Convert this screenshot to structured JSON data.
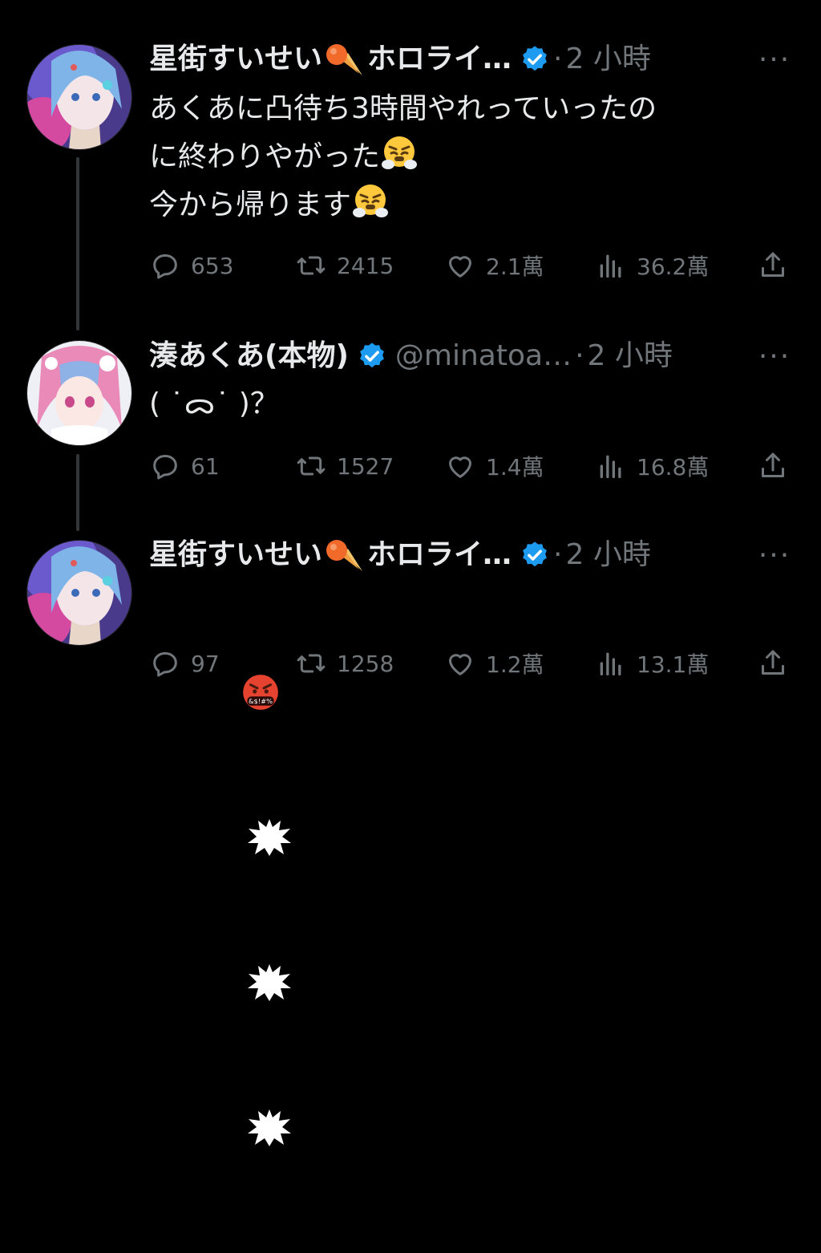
{
  "tweets": [
    {
      "name_prefix": "星街すいせい",
      "name_suffix": "ホロライ…",
      "handle": "",
      "separator": "·",
      "time": "2 小時",
      "more": "···",
      "body_lines": [
        "あくあに凸待ち3時間やれっていったの",
        "に終わりやがった",
        "今から帰ります"
      ],
      "body_emoji_name": "face-with-steam-from-nose-emoji",
      "replies": "653",
      "retweets": "2415",
      "likes": "2.1萬",
      "views": "36.2萬"
    },
    {
      "name_prefix": "湊あくあ(本物)",
      "name_suffix": "",
      "handle": "@minatoa…",
      "separator": "·",
      "time": "2 小時",
      "more": "···",
      "body_lines": [
        "( ˙ᯅ˙ )？"
      ],
      "replies": "61",
      "retweets": "1527",
      "likes": "1.4萬",
      "views": "16.8萬"
    },
    {
      "name_prefix": "星街すいせい",
      "name_suffix": "ホロライ…",
      "handle": "",
      "separator": "·",
      "time": "2 小時",
      "more": "···",
      "body_emoji_name": "face-with-symbols-on-mouth-emoji",
      "body_emoji_text": "&$!#%",
      "replies": "97",
      "retweets": "1258",
      "likes": "1.2萬",
      "views": "13.1萬"
    }
  ],
  "colors": {
    "background": "#000000",
    "text": "#e7e9ea",
    "muted": "#71767b",
    "verified": "#1d9bf0",
    "thread_line": "#333639"
  }
}
